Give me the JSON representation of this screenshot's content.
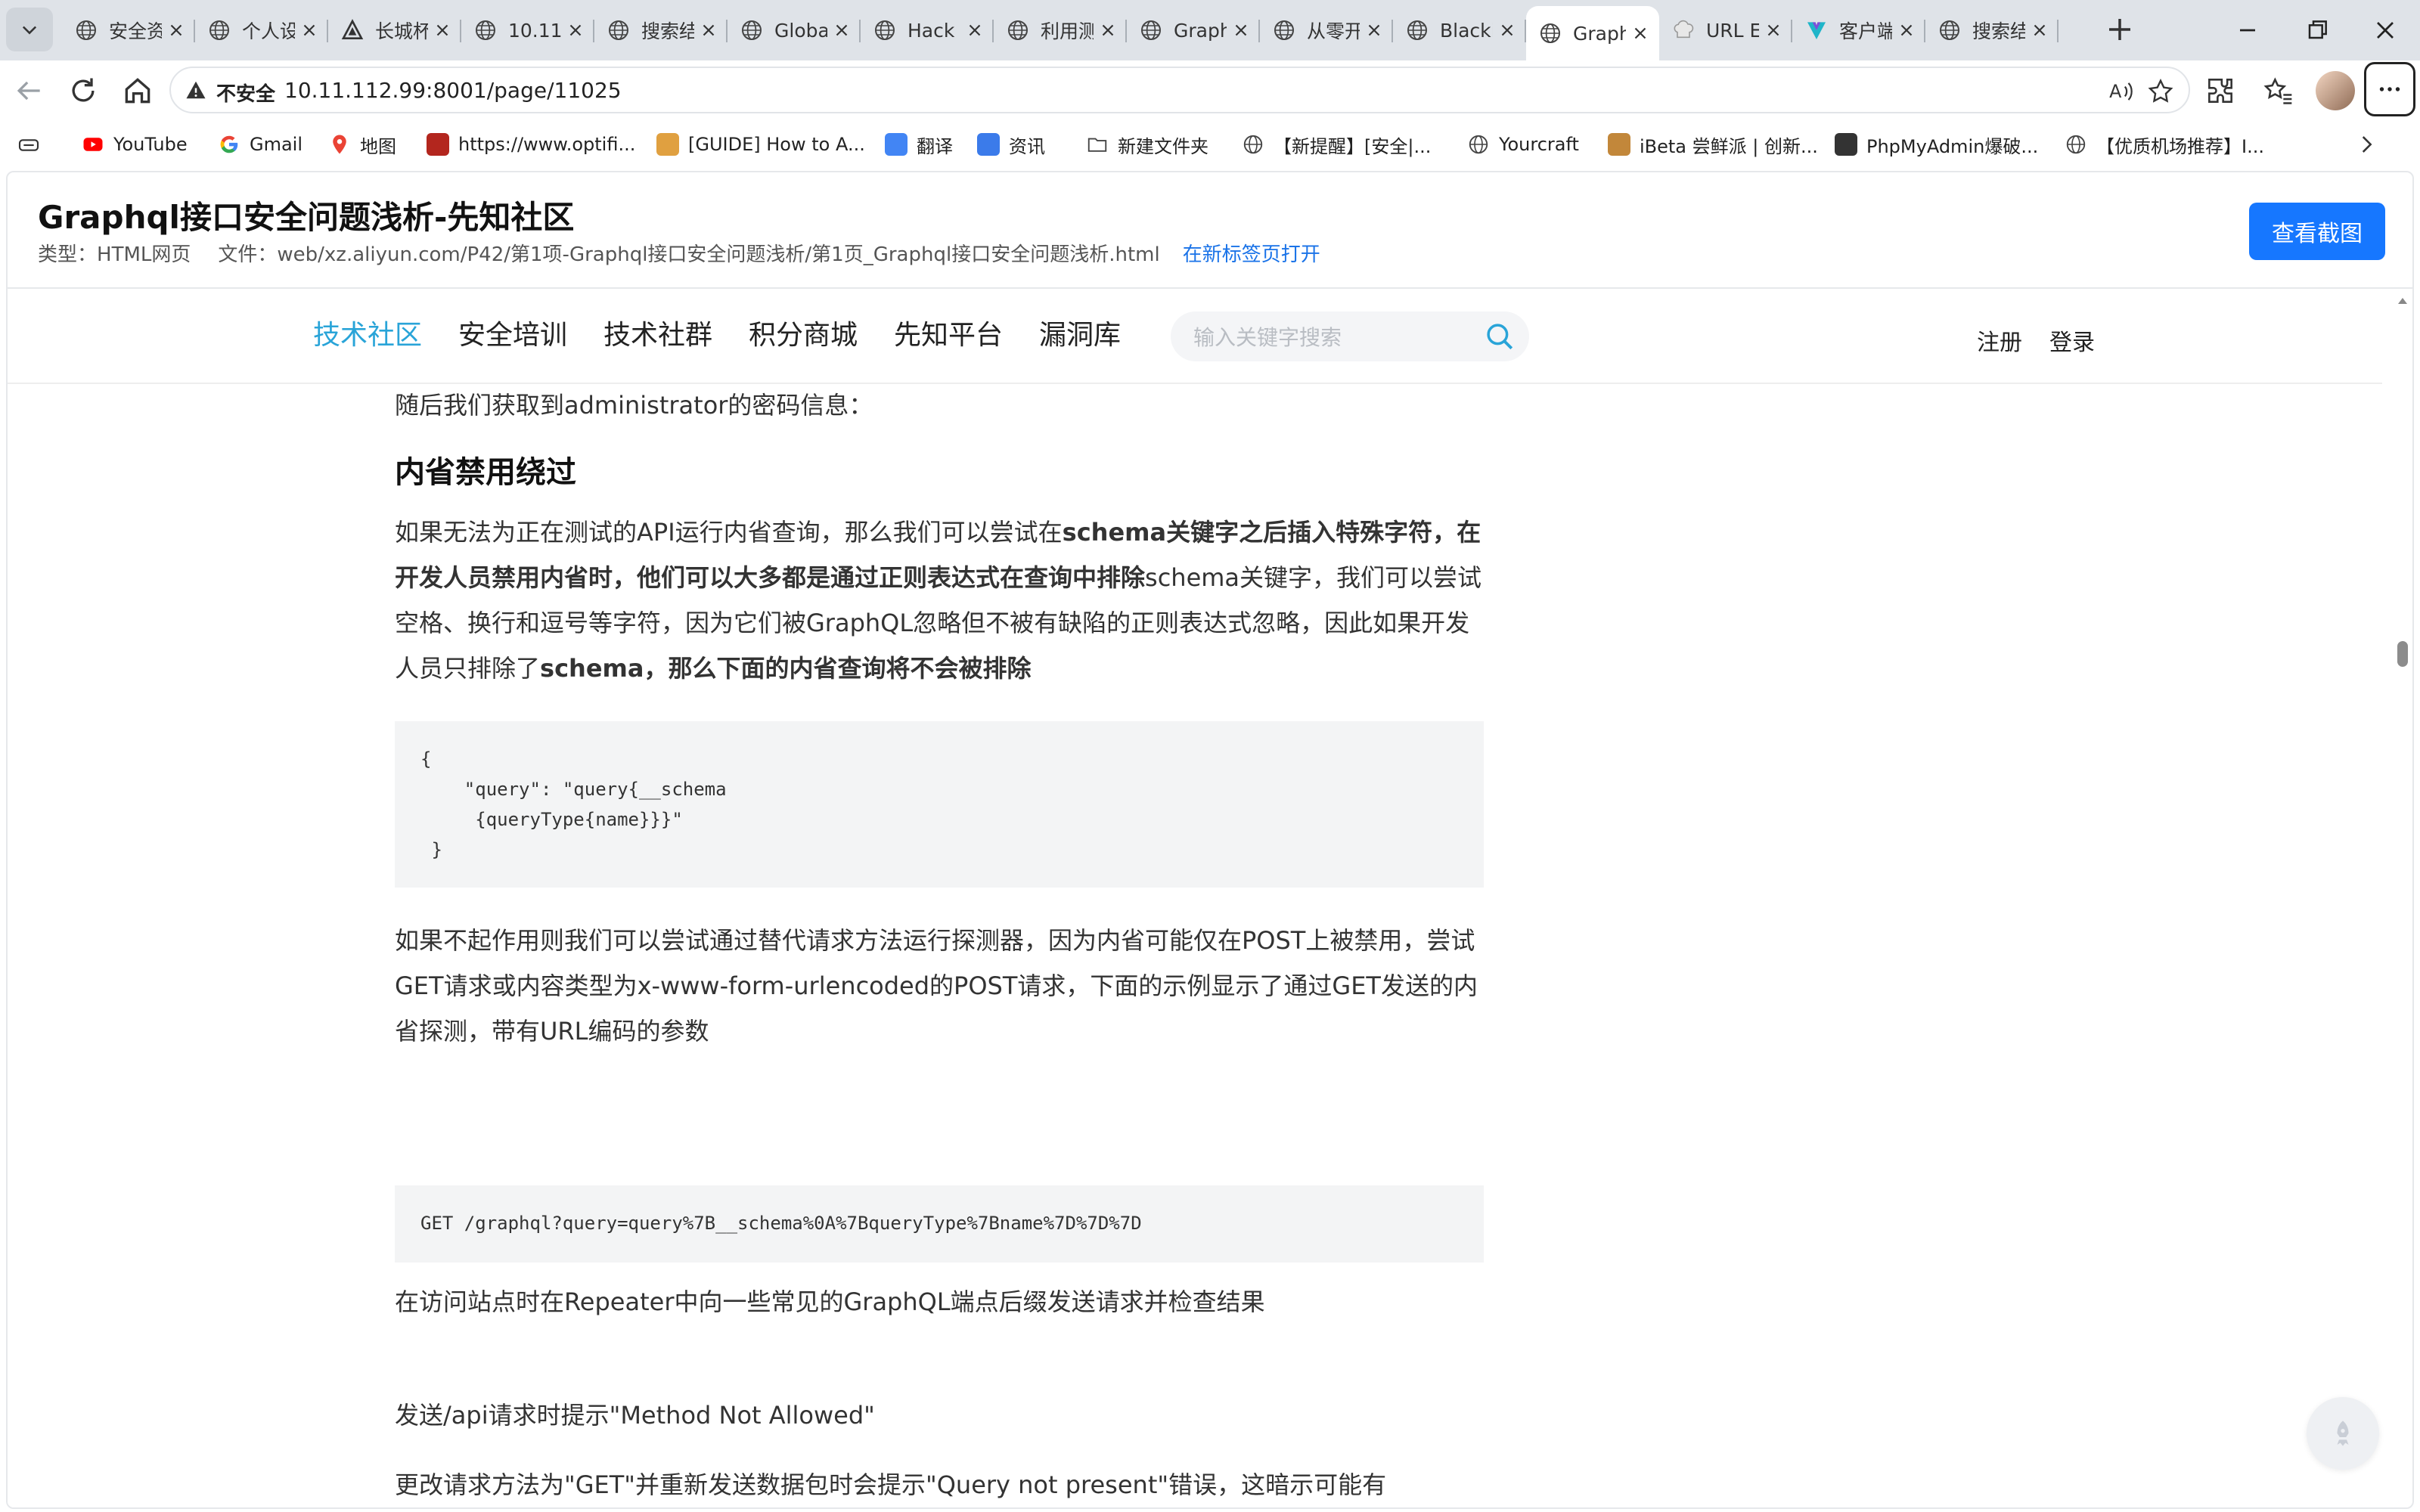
{
  "browser": {
    "tabs": [
      {
        "title": "安全资",
        "icon": "globe-icon"
      },
      {
        "title": "个人设",
        "icon": "globe-icon"
      },
      {
        "title": "长城杯",
        "icon": "triangle-logo-icon"
      },
      {
        "title": "10.11.",
        "icon": "globe-icon"
      },
      {
        "title": "搜索结",
        "icon": "globe-icon"
      },
      {
        "title": "Global",
        "icon": "globe-icon"
      },
      {
        "title": "Hack T",
        "icon": "globe-icon"
      },
      {
        "title": "利用测",
        "icon": "globe-icon"
      },
      {
        "title": "Graph",
        "icon": "globe-icon"
      },
      {
        "title": "从零开",
        "icon": "globe-icon"
      },
      {
        "title": "Blacki",
        "icon": "globe-icon"
      },
      {
        "title": "Graph",
        "icon": "globe-icon",
        "active": true
      },
      {
        "title": "URL E",
        "icon": "chef-hat-icon"
      },
      {
        "title": "客户端",
        "icon": "v-logo-icon"
      },
      {
        "title": "搜索结",
        "icon": "globe-icon"
      }
    ],
    "address": {
      "security_label": "不安全",
      "url": "10.11.112.99:8001/page/11025"
    },
    "bookmarks": [
      {
        "label": "YouTube",
        "icon": "youtube-icon",
        "color": "#ff0000"
      },
      {
        "label": "Gmail",
        "icon": "google-icon",
        "color": "#4285f4"
      },
      {
        "label": "地图",
        "icon": "maps-pin-icon",
        "color": "#34a853"
      },
      {
        "label": "https://www.optifi...",
        "icon": "optifine-icon",
        "color": "#b3261e"
      },
      {
        "label": "[GUIDE] How to A...",
        "icon": "guide-icon",
        "color": "#e0a040"
      },
      {
        "label": "翻译",
        "icon": "translate-icon",
        "color": "#4285f4"
      },
      {
        "label": "资讯",
        "icon": "news-icon",
        "color": "#3b7bea"
      },
      {
        "label": "新建文件夹",
        "icon": "folder-icon",
        "color": "#444444"
      },
      {
        "label": "【新提醒】[安全|...",
        "icon": "globe-icon",
        "color": "#444444"
      },
      {
        "label": "Yourcraft",
        "icon": "globe-icon",
        "color": "#444444"
      },
      {
        "label": "iBeta 尝鲜派 | 创新...",
        "icon": "ibeta-icon",
        "color": "#c2873a"
      },
      {
        "label": "PhpMyAdmin爆破...",
        "icon": "chm-icon",
        "color": "#333333"
      },
      {
        "label": "【优质机场推荐】I...",
        "icon": "globe-icon",
        "color": "#444444"
      }
    ]
  },
  "viewer": {
    "title": "Graphql接口安全问题浅析-先知社区",
    "type_label": "类型：",
    "type_value": "HTML网页",
    "file_label": "文件：",
    "file_value": "web/xz.aliyun.com/P42/第1项-Graphql接口安全问题浅析/第1页_Graphql接口安全问题浅析.html",
    "open_link": "在新标签页打开",
    "screenshot_button": "查看截图",
    "accent_color": "#1677ff"
  },
  "site": {
    "nav": [
      "技术社区",
      "安全培训",
      "技术社群",
      "积分商城",
      "先知平台",
      "漏洞库"
    ],
    "active_nav": "技术社区",
    "active_color": "#29a4d8",
    "search_placeholder": "输入关键字搜索",
    "register": "注册",
    "login": "登录"
  },
  "article": {
    "p_intro": "随后我们获取到administrator的密码信息：",
    "h_bypass": "内省禁用绕过",
    "p1_line1_a": "如果无法为正在测试的API运行内省查询，那么我们可以尝试在",
    "p1_line1_b": "schema关键字之后插入特殊字符，在",
    "p1_line2_a": "开发人员禁用内省时，他们可以大多都是通过正则表达式在查询中排除",
    "p1_line2_b": "schema关键字，我们可以尝试",
    "p1_line3": "空格、换行和逗号等字符，因为它们被GraphQL忽略但不被有缺陷的正则表达式忽略，因此如果开发",
    "p1_line4_a": "人员只排除了",
    "p1_line4_b": "schema，那么下面的内省查询将不会被排除",
    "code1": "{\n    \"query\": \"query{__schema\n     {queryType{name}}}\"\n }",
    "p2": "如果不起作用则我们可以尝试通过替代请求方法运行探测器，因为内省可能仅在POST上被禁用，尝试GET请求或内容类型为x-www-form-urlencoded的POST请求，下面的示例显示了通过GET发送的内省探测，带有URL编码的参数",
    "code2": "GET /graphql?query=query%7B__schema%0A%7BqueryType%7Bname%7D%7D%7D",
    "p3": "在访问站点时在Repeater中向一些常见的GraphQL端点后缀发送请求并检查结果",
    "p4": "发送/api请求时提示\"Method Not Allowed\"",
    "p5": "更改请求方法为\"GET\"并重新发送数据包时会提示\"Query not present\"错误，这暗示可能有一个GraphQL端点响应此位置的GET请求"
  }
}
